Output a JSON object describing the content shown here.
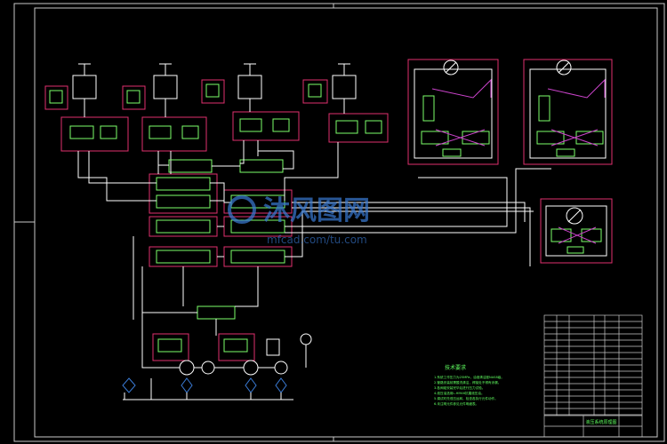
{
  "watermark": {
    "cn": "沐风图网",
    "url": "mfcad.com/tu.com"
  },
  "notes": {
    "title": "技术要求",
    "lines": [
      "1.系统工作压力为25MPa，油液清洁度NAS8级。",
      "2.管路安装前需酸洗清洁，焊接处不得有渗漏。",
      "3.各阀组安装完毕后进行压力试验。",
      "4.液压油选用L-HM46抗磨液压油。",
      "5.调试时先低压运转，检查各执行元件动作。",
      "6.未注明元件参见元件明细表。"
    ]
  },
  "title_block": {
    "drawing_name": "液压系统原理图"
  },
  "colors": {
    "line": "#ffffff",
    "frame": "#c8c8c8",
    "component": "#7cff6a",
    "box": "#e0306e",
    "pipe": "#cc44cc",
    "text": "#60ff60",
    "accent_blue": "#3a7bd5"
  }
}
